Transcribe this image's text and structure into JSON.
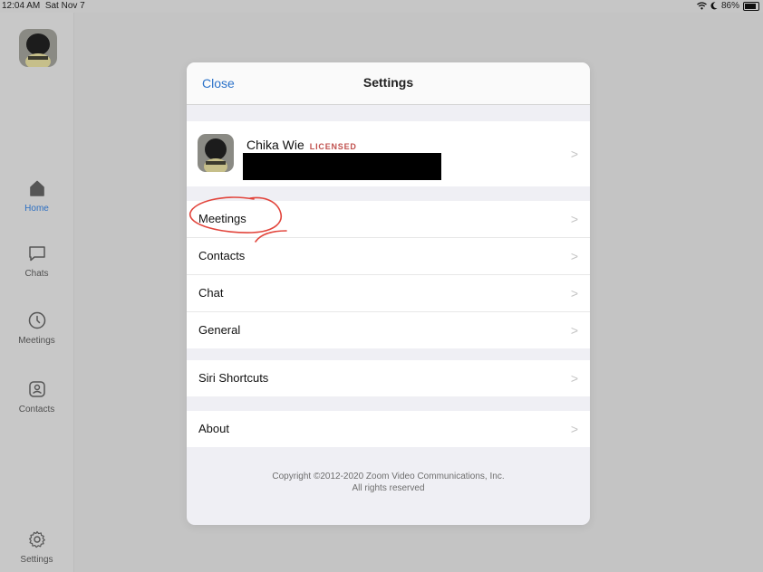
{
  "status_bar": {
    "time": "12:04 AM",
    "date": "Sat Nov 7",
    "battery": "86%",
    "battery_fraction": 0.86
  },
  "sidebar": {
    "items": [
      {
        "label": "Home",
        "icon": "home-icon",
        "active": true
      },
      {
        "label": "Chats",
        "icon": "chat-bubble-icon",
        "active": false
      },
      {
        "label": "Meetings",
        "icon": "clock-icon",
        "active": false
      },
      {
        "label": "Contacts",
        "icon": "contact-card-icon",
        "active": false
      },
      {
        "label": "Settings",
        "icon": "gear-icon",
        "active": false
      }
    ]
  },
  "modal": {
    "close_label": "Close",
    "title": "Settings",
    "profile": {
      "name": "Chika Wie",
      "badge": "LICENSED"
    },
    "groups": [
      [
        "Meetings",
        "Contacts",
        "Chat",
        "General"
      ],
      [
        "Siri Shortcuts"
      ],
      [
        "About"
      ]
    ],
    "copyright_line1": "Copyright ©2012-2020 Zoom Video Communications, Inc.",
    "copyright_line2": "All rights reserved"
  },
  "colors": {
    "accent": "#2b72c9",
    "badge": "#c0504d",
    "annotation": "#e2453c"
  }
}
